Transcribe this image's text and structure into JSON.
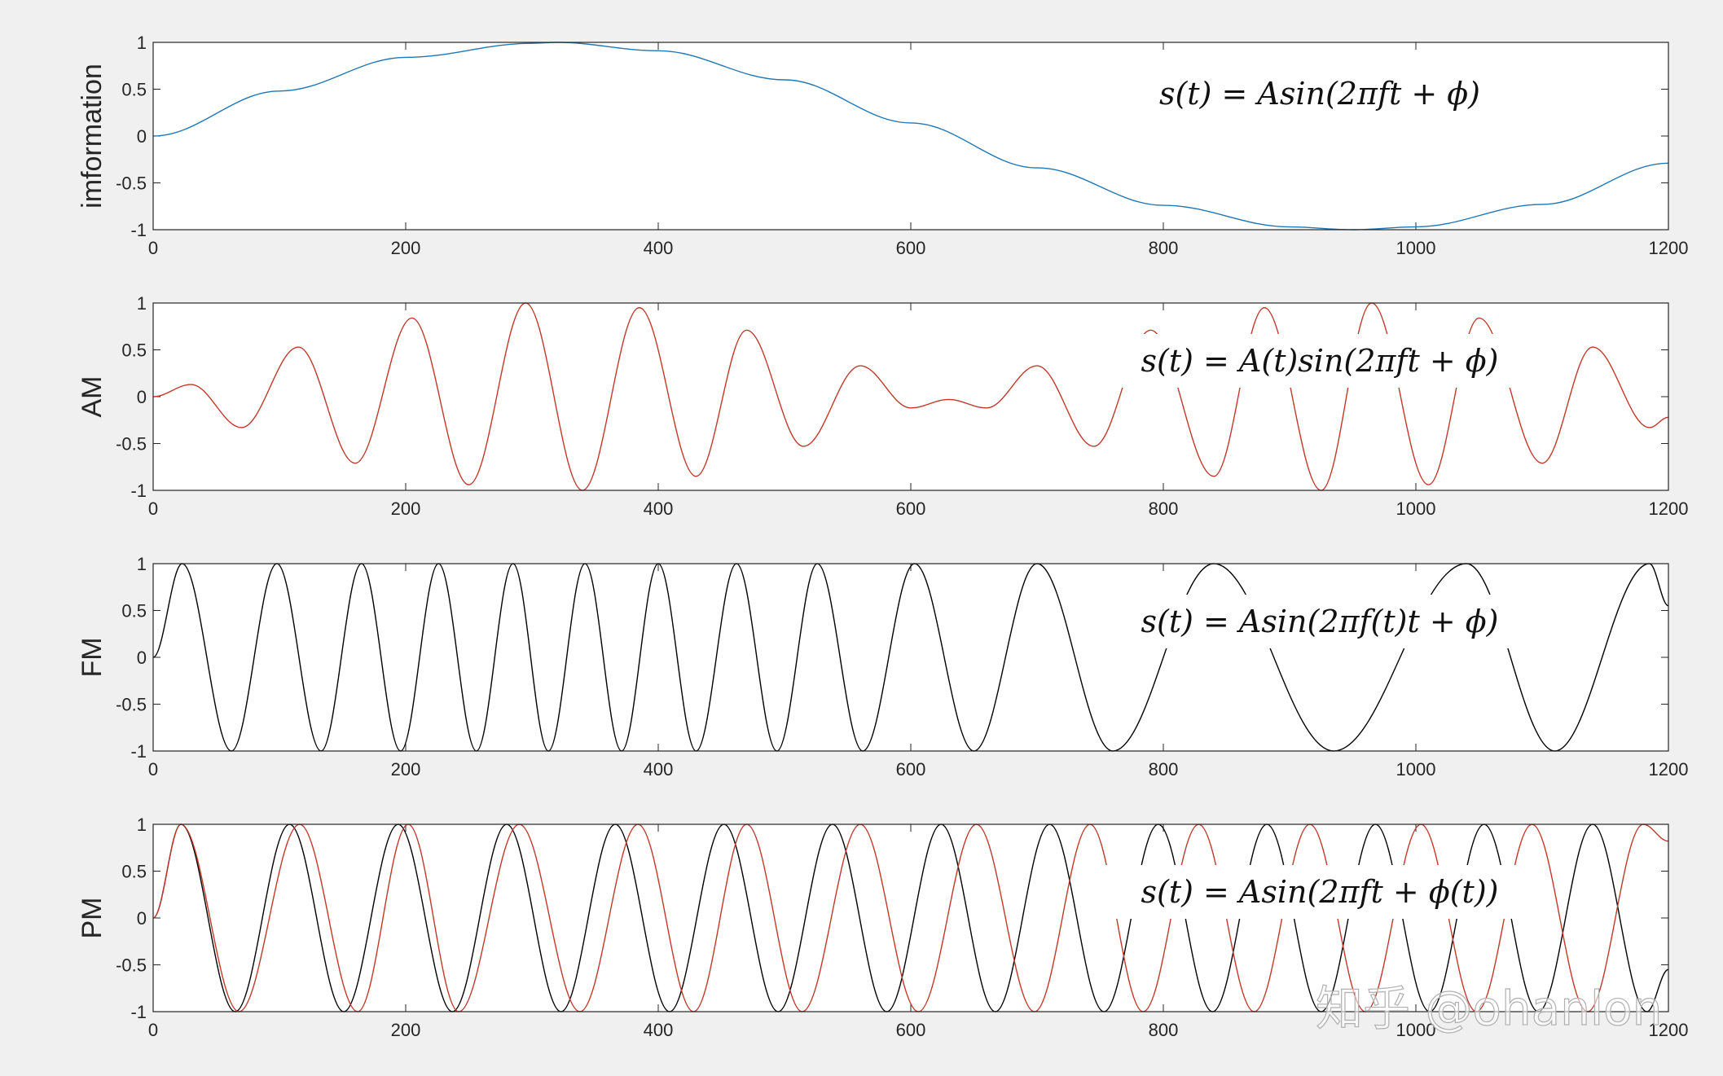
{
  "watermark": "知乎 @ohanlon",
  "chart_data": [
    {
      "type": "line",
      "ylabel": "imformation",
      "formula": "s(t)  = Asin(2πft + ϕ)",
      "xlim": [
        0,
        1200
      ],
      "ylim": [
        -1,
        1
      ],
      "xticks": [
        0,
        200,
        400,
        600,
        800,
        1000,
        1200
      ],
      "yticks": [
        -1,
        -0.5,
        0,
        0.5,
        1
      ],
      "series": [
        {
          "color": "#1f77b4",
          "x": [
            0,
            100,
            200,
            300,
            320,
            400,
            500,
            600,
            700,
            800,
            900,
            950,
            1000,
            1100,
            1200
          ],
          "y": [
            0,
            0.48,
            0.84,
            0.99,
            1.0,
            0.91,
            0.6,
            0.14,
            -0.34,
            -0.74,
            -0.97,
            -1.0,
            -0.97,
            -0.73,
            -0.29
          ]
        }
      ]
    },
    {
      "type": "line",
      "ylabel": "AM",
      "formula": "s(t)  = A(t)sin(2πft + ϕ)",
      "xlim": [
        0,
        1200
      ],
      "ylim": [
        -1,
        1
      ],
      "xticks": [
        0,
        200,
        400,
        600,
        800,
        1000,
        1200
      ],
      "yticks": [
        -1,
        -0.5,
        0,
        0.5,
        1
      ],
      "series": [
        {
          "color": "#c0392b",
          "x": [
            0,
            30,
            70,
            115,
            160,
            205,
            250,
            295,
            340,
            385,
            430,
            470,
            515,
            560,
            600,
            630,
            660,
            700,
            745,
            790,
            840,
            880,
            925,
            965,
            1010,
            1050,
            1100,
            1140,
            1185,
            1200
          ],
          "y": [
            0,
            0.13,
            -0.33,
            0.53,
            -0.71,
            0.84,
            -0.94,
            1.0,
            -1.0,
            0.95,
            -0.85,
            0.71,
            -0.53,
            0.33,
            -0.12,
            -0.03,
            -0.12,
            0.33,
            -0.53,
            0.71,
            -0.85,
            0.95,
            -1.0,
            1.0,
            -0.94,
            0.84,
            -0.71,
            0.53,
            -0.33,
            -0.22
          ]
        }
      ]
    },
    {
      "type": "line",
      "ylabel": "FM",
      "formula": "s(t)  = Asin(2πf(t)t + ϕ)",
      "xlim": [
        0,
        1200
      ],
      "ylim": [
        -1,
        1
      ],
      "xticks": [
        0,
        200,
        400,
        600,
        800,
        1000,
        1200
      ],
      "yticks": [
        -1,
        -0.5,
        0,
        0.5,
        1
      ],
      "series": [
        {
          "color": "#000000",
          "x": [
            0,
            23,
            62,
            98,
            133,
            165,
            196,
            226,
            256,
            285,
            313,
            342,
            371,
            400,
            430,
            462,
            494,
            526,
            562,
            603,
            650,
            700,
            760,
            840,
            935,
            1040,
            1110,
            1185,
            1200
          ],
          "y": [
            0,
            1,
            -1,
            1,
            -1,
            1,
            -1,
            1,
            -1,
            1,
            -1,
            1,
            -1,
            1,
            -1,
            1,
            -1,
            1,
            -1,
            1,
            -1,
            1,
            -1,
            1,
            -1,
            1,
            -1,
            1,
            0.55
          ]
        }
      ]
    },
    {
      "type": "line",
      "ylabel": "PM",
      "formula": "s(t)  = Asin(2πft + ϕ(t))",
      "xlim": [
        0,
        1200
      ],
      "ylim": [
        -1,
        1
      ],
      "xticks": [
        0,
        200,
        400,
        600,
        800,
        1000,
        1200
      ],
      "yticks": [
        -1,
        -0.5,
        0,
        0.5,
        1
      ],
      "series": [
        {
          "color": "#000000",
          "x": [
            0,
            22,
            65,
            108,
            151,
            194,
            237,
            280,
            323,
            366,
            409,
            452,
            495,
            538,
            581,
            624,
            667,
            710,
            753,
            796,
            839,
            882,
            925,
            968,
            1011,
            1054,
            1097,
            1140,
            1183,
            1200
          ],
          "y": [
            0,
            1,
            -1,
            1,
            -1,
            1,
            -1,
            1,
            -1,
            1,
            -1,
            1,
            -1,
            1,
            -1,
            1,
            -1,
            1,
            -1,
            1,
            -1,
            1,
            -1,
            1,
            -1,
            1,
            -1,
            1,
            -1,
            -0.55
          ]
        },
        {
          "color": "#c0392b",
          "x": [
            0,
            22,
            68,
            116,
            162,
            202,
            242,
            290,
            338,
            384,
            428,
            470,
            514,
            560,
            606,
            652,
            698,
            742,
            784,
            828,
            872,
            916,
            960,
            1004,
            1048,
            1092,
            1136,
            1180,
            1200
          ],
          "y": [
            0,
            1,
            -1,
            1,
            -1,
            1,
            -1,
            1,
            -1,
            1,
            -1,
            1,
            -1,
            1,
            -1,
            1,
            -1,
            1,
            -1,
            1,
            -1,
            1,
            -1,
            1,
            -1,
            1,
            -1,
            1,
            0.82
          ]
        }
      ]
    }
  ]
}
